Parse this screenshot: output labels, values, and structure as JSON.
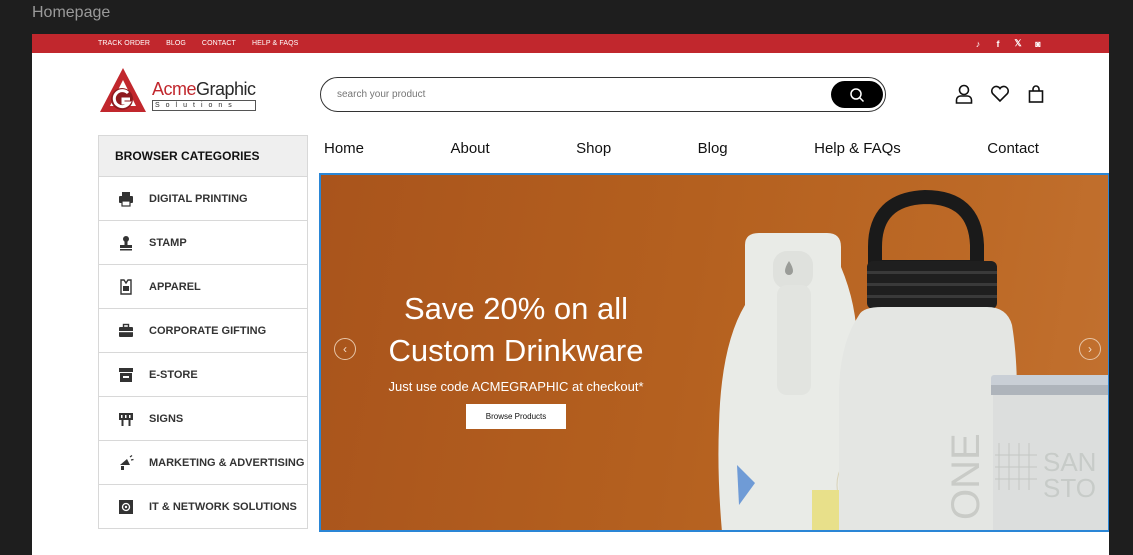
{
  "frame_title": "Homepage",
  "topbar": {
    "links": [
      "TRACK ORDER",
      "BLOG",
      "CONTACT",
      "HELP & FAQS"
    ],
    "social": [
      "tiktok-icon",
      "facebook-icon",
      "x-icon",
      "instagram-icon"
    ],
    "social_glyphs": [
      "♪",
      "f",
      "𝕏",
      "◙"
    ]
  },
  "logo": {
    "name_a": "Acme",
    "name_b": "Graphic",
    "sub": "Solutions"
  },
  "search": {
    "placeholder": "search your product"
  },
  "header_icons": [
    "user-icon",
    "heart-icon",
    "bag-icon"
  ],
  "sidebar": {
    "title": "BROWSER CATEGORIES",
    "items": [
      {
        "label": "DIGITAL PRINTING",
        "icon": "printer-icon"
      },
      {
        "label": "STAMP",
        "icon": "stamp-icon"
      },
      {
        "label": "APPAREL",
        "icon": "apparel-icon"
      },
      {
        "label": "CORPORATE GIFTING",
        "icon": "briefcase-icon"
      },
      {
        "label": "E-STORE",
        "icon": "store-icon"
      },
      {
        "label": "SIGNS",
        "icon": "sign-icon"
      },
      {
        "label": "MARKETING & ADVERTISING",
        "icon": "megaphone-icon"
      },
      {
        "label": "IT & NETWORK SOLUTIONS",
        "icon": "network-icon"
      }
    ]
  },
  "nav": [
    "Home",
    "About",
    "Shop",
    "Blog",
    "Help & FAQs",
    "Contact"
  ],
  "banner": {
    "title_line1": "Save 20% on all",
    "title_line2": "Custom Drinkware",
    "subtitle": "Just use code ACMEGRAPHIC at checkout*",
    "button": "Browse Products",
    "bottle_text_1": "ONE",
    "bottle_text_2a": "SAN",
    "bottle_text_2b": "STO"
  },
  "colors": {
    "brand_red": "#c1272d",
    "banner_brown": "#b4601f",
    "selection_blue": "#2a86d6"
  }
}
